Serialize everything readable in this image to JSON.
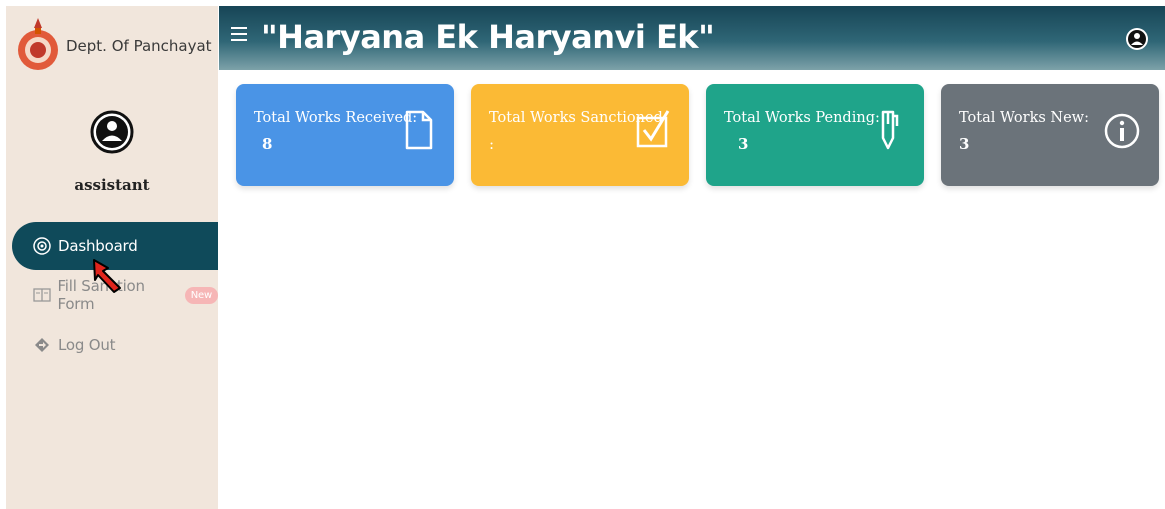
{
  "sidebar": {
    "brand": "Dept. Of Panchayat",
    "username": "assistant",
    "items": [
      {
        "label": "Dashboard",
        "icon": "dashboard-icon",
        "active": true
      },
      {
        "label": "Fill Sanction Form",
        "icon": "form-icon",
        "badge": "New"
      },
      {
        "label": "Log Out",
        "icon": "logout-icon"
      }
    ]
  },
  "header": {
    "title": "\"Haryana Ek Haryanvi Ek\"",
    "menu_icon": "hamburger-icon",
    "user_icon": "user-circle-icon"
  },
  "cards": [
    {
      "label": "Total Works Received:",
      "value": "8",
      "color": "#4a94e6",
      "icon": "document-icon"
    },
    {
      "label": "Total Works Sanctioned",
      "value": ":",
      "color": "#fbba35",
      "icon": "checkbox-icon"
    },
    {
      "label": "Total Works Pending:",
      "value": "3",
      "color": "#1fa48a",
      "icon": "pen-icon"
    },
    {
      "label": "Total Works New:",
      "value": "3",
      "color": "#6b737a",
      "icon": "info-icon"
    }
  ],
  "colors": {
    "header_dark": "#174556",
    "sidebar_bg": "#f1e6dc",
    "active_nav": "#0f4a5a"
  }
}
